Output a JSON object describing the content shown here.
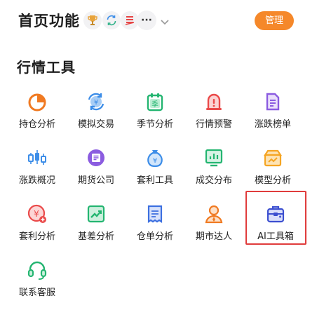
{
  "header": {
    "title": "首页功能",
    "manage_label": "管理",
    "badge_icons": [
      "trophy-icon",
      "exchange-icon",
      "red-flag-icon"
    ],
    "more_glyph": "···"
  },
  "section": {
    "title": "行情工具"
  },
  "tools": [
    {
      "label": "持仓分析",
      "icon": "pie-chart-icon",
      "color": "#f07a22"
    },
    {
      "label": "模拟交易",
      "icon": "simulated-trade-icon",
      "color": "#3c8de8"
    },
    {
      "label": "季节分析",
      "icon": "season-calendar-icon",
      "color": "#24b571"
    },
    {
      "label": "行情预警",
      "icon": "alert-bell-icon",
      "color": "#ea4a4a"
    },
    {
      "label": "涨跌榜单",
      "icon": "ranking-list-icon",
      "color": "#8b5ce0"
    },
    {
      "label": "涨跌概况",
      "icon": "candlestick-icon",
      "color": "#3c8de8"
    },
    {
      "label": "期货公司",
      "icon": "company-icon",
      "color": "#8b5ce0"
    },
    {
      "label": "套利工具",
      "icon": "money-bag-icon",
      "color": "#3c8de8"
    },
    {
      "label": "成交分布",
      "icon": "volume-distribution-icon",
      "color": "#24b571"
    },
    {
      "label": "模型分析",
      "icon": "model-box-icon",
      "color": "#f5a523"
    },
    {
      "label": "套利分析",
      "icon": "arbitrage-coin-icon",
      "color": "#ea4a4a"
    },
    {
      "label": "基差分析",
      "icon": "basis-trend-icon",
      "color": "#24b571"
    },
    {
      "label": "仓单分析",
      "icon": "warehouse-receipt-icon",
      "color": "#3c6fe0"
    },
    {
      "label": "期市达人",
      "icon": "expert-person-icon",
      "color": "#f07a22"
    },
    {
      "label": "AI工具箱",
      "icon": "toolbox-icon",
      "color": "#3c4fd0"
    },
    {
      "label": "联系客服",
      "icon": "headset-icon",
      "color": "#24b571"
    }
  ]
}
